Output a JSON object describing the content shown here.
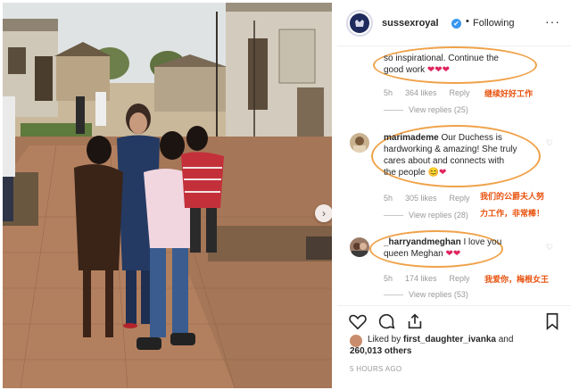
{
  "header": {
    "username": "sussexroyal",
    "verified_mark": "✔",
    "separator": "•",
    "follow_status": "Following",
    "more_label": "···"
  },
  "comments": [
    {
      "text_line1": "so inspirational. Continue the",
      "text_line2": "good work",
      "emoji": "❤❤❤",
      "time": "5h",
      "likes": "364 likes",
      "reply": "Reply",
      "view_replies": "View replies (25)",
      "translation": "继续好好工作"
    },
    {
      "username": "marimademe",
      "text_line1": "Our Duchess is",
      "text_line2": "hardworking & amazing! She truly",
      "text_line3": "cares about and connects with",
      "text_line4": "the people",
      "emoji": "😊❤",
      "time": "5h",
      "likes": "305 likes",
      "reply": "Reply",
      "view_replies": "View replies (28)",
      "translation_line1": "我们的公爵夫人努",
      "translation_line2": "力工作，非常棒！"
    },
    {
      "username": "_harryandmeghan",
      "text_line1": "I love you",
      "text_line2": "queen Meghan",
      "emoji": "❤❤",
      "time": "5h",
      "likes": "174 likes",
      "reply": "Reply",
      "view_replies": "View replies (53)",
      "translation": "我爱你，梅根女王"
    }
  ],
  "actions": {
    "like_icon": "heart-icon",
    "comment_icon": "comment-icon",
    "share_icon": "share-icon",
    "save_icon": "bookmark-icon"
  },
  "likes_summary": {
    "prefix": "Liked by",
    "user": "first_daughter_ivanka",
    "and": "and",
    "count": "260,013 others"
  },
  "time_ago": "5 HOURS AGO",
  "colors": {
    "accent": "#3897f0",
    "annotation": "#e8520e",
    "ring": "#f0a24a"
  }
}
